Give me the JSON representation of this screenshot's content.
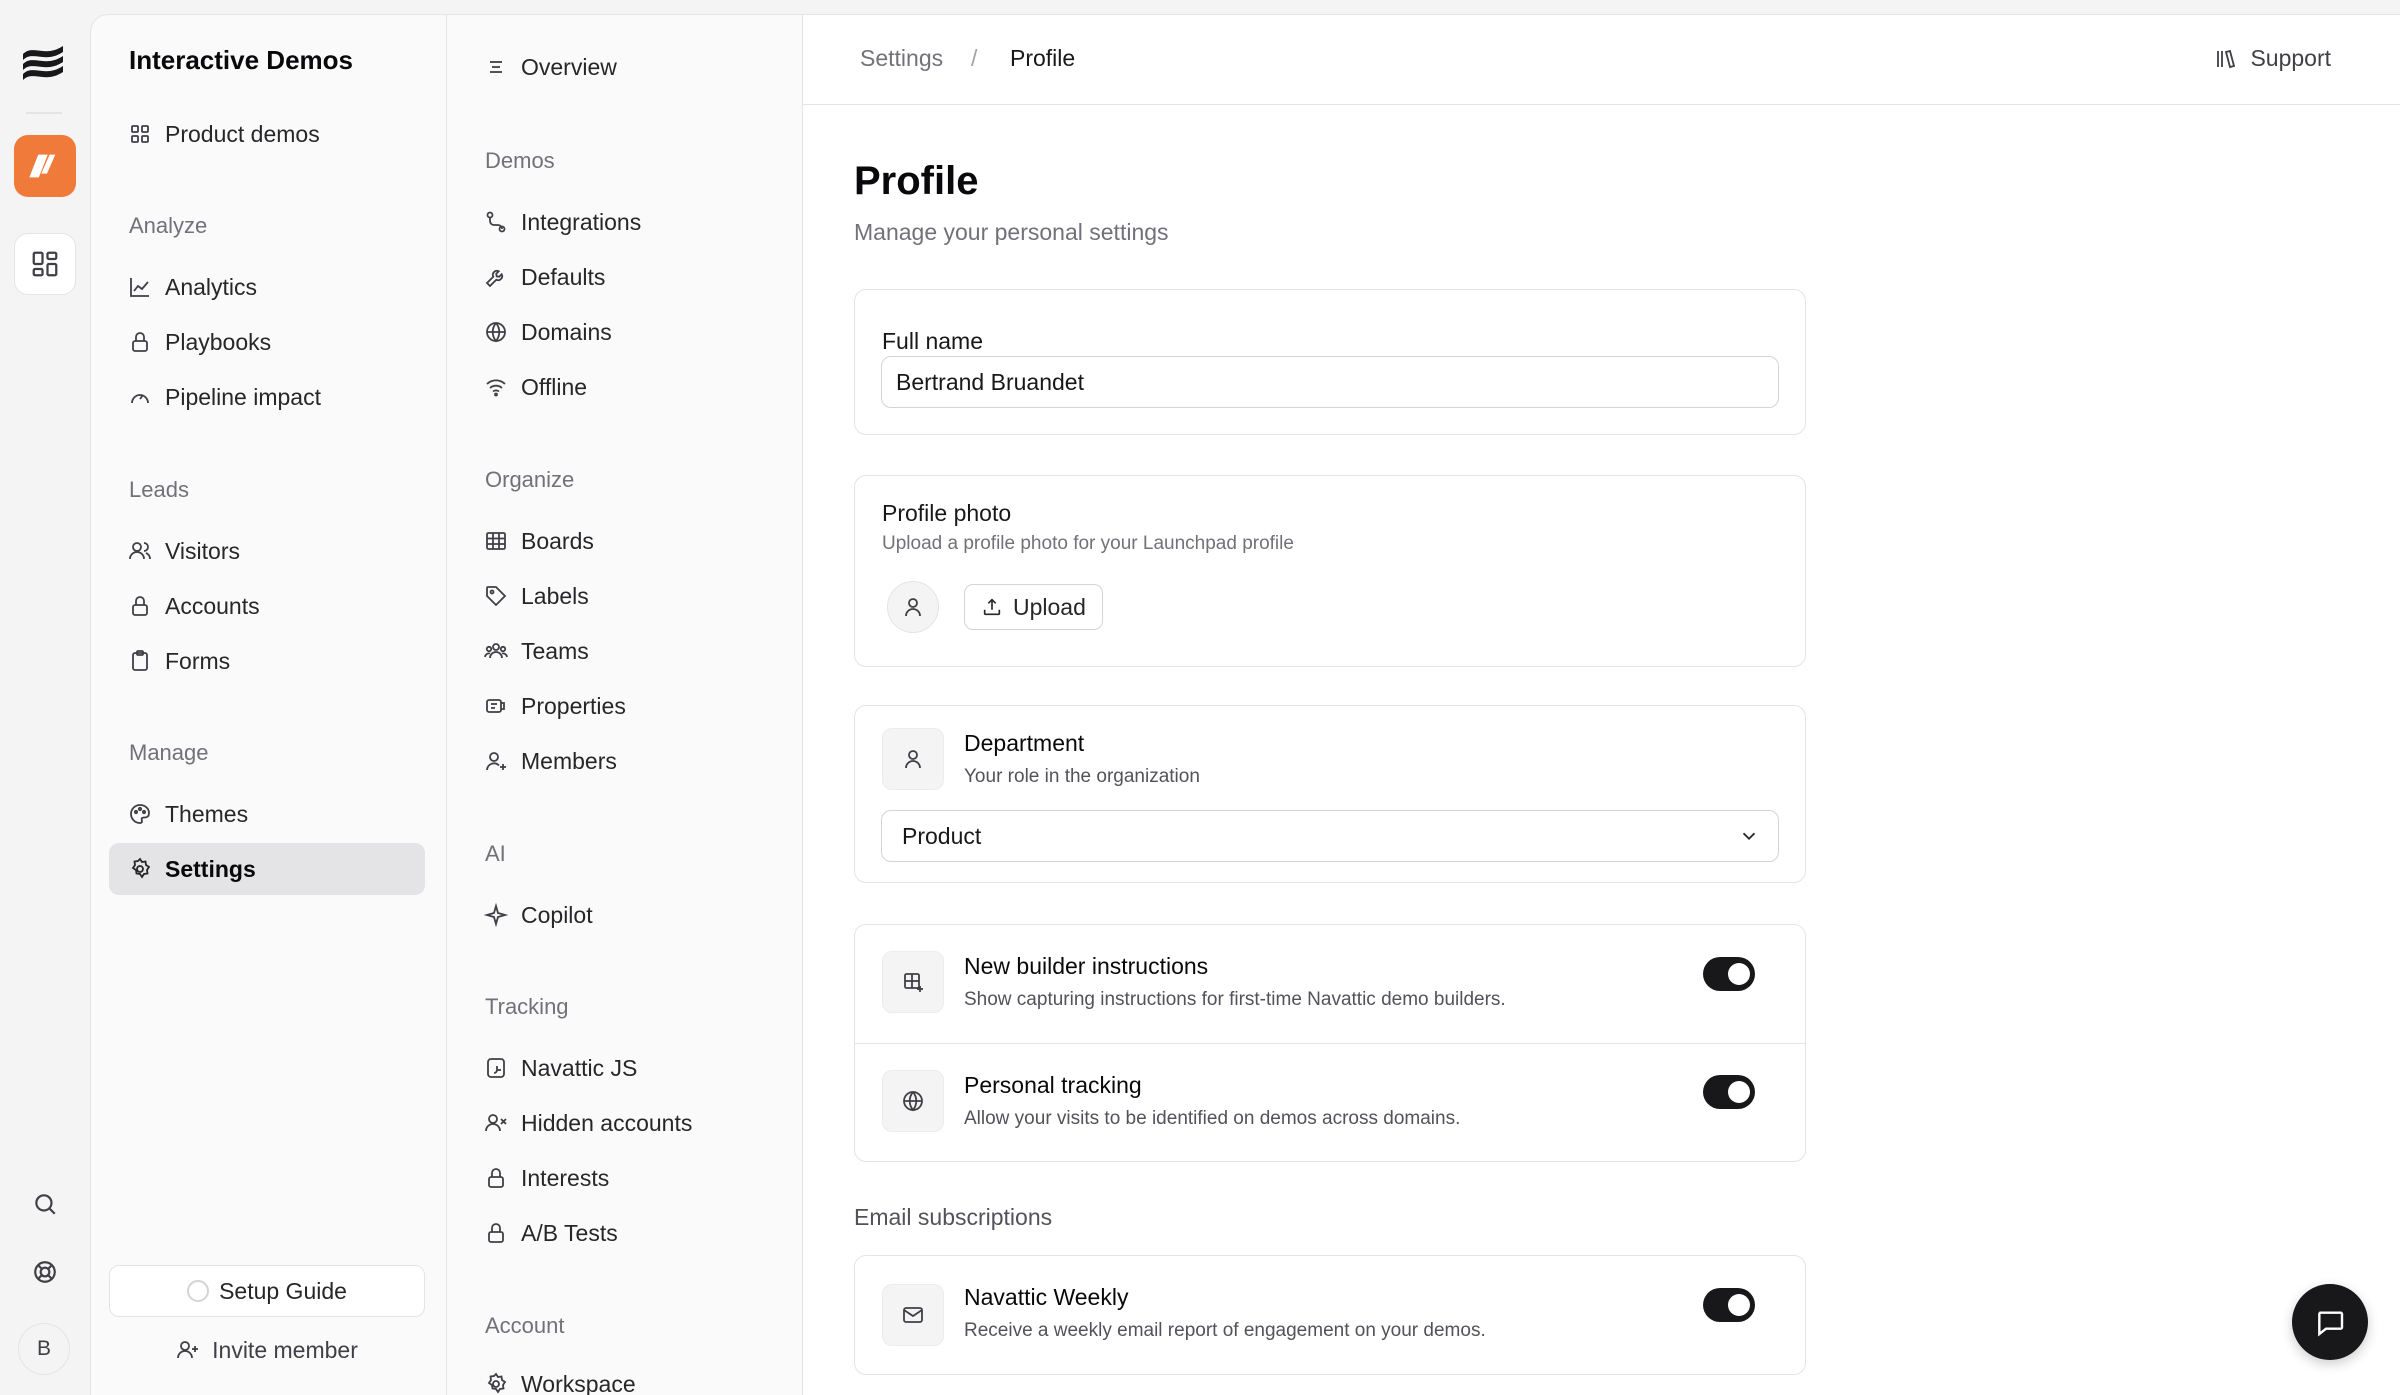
{
  "app": {
    "panel_title": "Interactive Demos",
    "avatar_initial": "B"
  },
  "panel1": {
    "top_item": "Product demos",
    "sections": [
      {
        "label": "Analyze",
        "items": [
          "Analytics",
          "Playbooks",
          "Pipeline impact"
        ]
      },
      {
        "label": "Leads",
        "items": [
          "Visitors",
          "Accounts",
          "Forms"
        ]
      },
      {
        "label": "Manage",
        "items": [
          "Themes",
          "Settings"
        ]
      }
    ],
    "setup_guide": "Setup Guide",
    "invite_member": "Invite member"
  },
  "panel2": {
    "overview": "Overview",
    "sections": [
      {
        "label": "Demos",
        "items": [
          "Integrations",
          "Defaults",
          "Domains",
          "Offline"
        ]
      },
      {
        "label": "Organize",
        "items": [
          "Boards",
          "Labels",
          "Teams",
          "Properties",
          "Members"
        ]
      },
      {
        "label": "AI",
        "items": [
          "Copilot"
        ]
      },
      {
        "label": "Tracking",
        "items": [
          "Navattic JS",
          "Hidden accounts",
          "Interests",
          "A/B Tests"
        ]
      },
      {
        "label": "Account",
        "items": [
          "Workspace"
        ]
      }
    ]
  },
  "topbar": {
    "breadcrumb_root": "Settings",
    "breadcrumb_sep": "/",
    "breadcrumb_current": "Profile",
    "support": "Support"
  },
  "profile": {
    "title": "Profile",
    "subtitle": "Manage your personal settings",
    "full_name_label": "Full name",
    "full_name_value": "Bertrand Bruandet",
    "photo_label": "Profile photo",
    "photo_hint": "Upload a profile photo for your Launchpad profile",
    "upload_label": "Upload",
    "department_title": "Department",
    "department_desc": "Your role in the organization",
    "department_value": "Product",
    "builder_title": "New builder instructions",
    "builder_desc": "Show capturing instructions for first-time Navattic demo builders.",
    "builder_enabled": true,
    "tracking_title": "Personal tracking",
    "tracking_desc": "Allow your visits to be identified on demos across domains.",
    "tracking_enabled": true,
    "email_section": "Email subscriptions",
    "weekly_title": "Navattic Weekly",
    "weekly_desc": "Receive a weekly email report of engagement on your demos.",
    "weekly_enabled": true
  },
  "colors": {
    "accent_app": "#f07a3a",
    "toggle_on": "#18181b",
    "active_nav": "#e4e4e7"
  }
}
